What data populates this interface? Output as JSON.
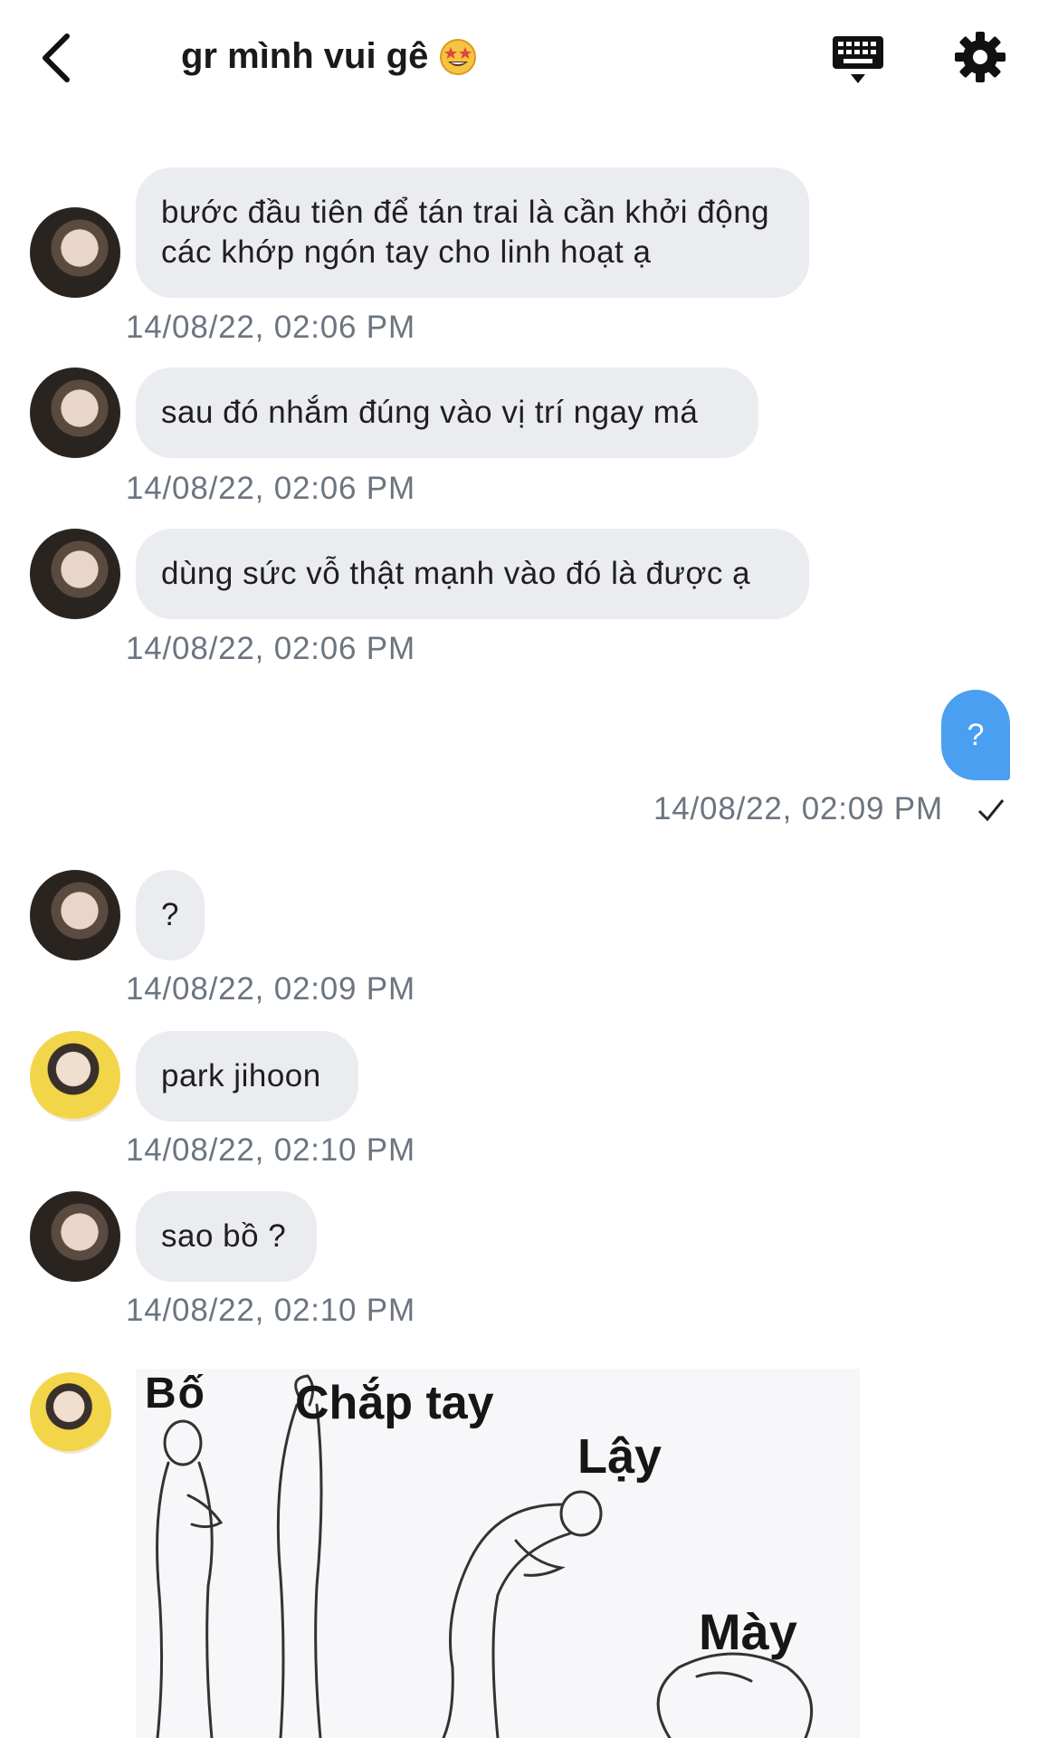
{
  "header": {
    "title": "gr mình vui gê",
    "title_emoji": "star-struck-emoji"
  },
  "messages": [
    {
      "text": "bước đầu tiên để tán trai là cần khởi động các khớp ngón tay cho linh hoạt ạ",
      "time": "14/08/22, 02:06 PM"
    },
    {
      "text": "sau đó nhắm đúng vào vị trí ngay má",
      "time": "14/08/22, 02:06 PM"
    },
    {
      "text": "dùng sức vỗ thật mạnh vào đó là được ạ",
      "time": "14/08/22, 02:06 PM"
    },
    {
      "text": "?",
      "time": "14/08/22, 02:09 PM",
      "outgoing": true
    },
    {
      "text": "?",
      "time": "14/08/22, 02:09 PM"
    },
    {
      "text": "park jihoon",
      "time": "14/08/22, 02:10 PM"
    },
    {
      "text": "sao bồ ?",
      "time": "14/08/22, 02:10 PM"
    }
  ],
  "sticker": {
    "labels": [
      "Bố",
      "Chắp tay",
      "Lậy",
      "Mày"
    ]
  },
  "colors": {
    "incoming_bubble": "#eaecef",
    "outgoing_bubble": "#4a9ff0",
    "timestamp": "#6b7580"
  }
}
